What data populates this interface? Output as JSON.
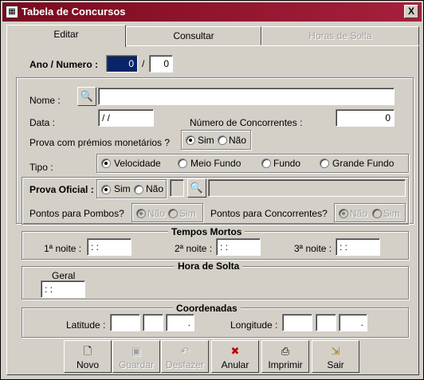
{
  "window": {
    "title": "Tabela de Concursos",
    "close_symbol": "X"
  },
  "tabs": [
    {
      "label": "Editar",
      "state": "active"
    },
    {
      "label": "Consultar",
      "state": "enabled"
    },
    {
      "label": "Horas de Solta",
      "state": "disabled"
    }
  ],
  "ano_numero": {
    "label": "Ano / Numero :",
    "ano": "0",
    "separator": "/",
    "numero": "0"
  },
  "nome": {
    "label": "Nome :",
    "value": ""
  },
  "data": {
    "label": "Data :",
    "value": " / /"
  },
  "num_concorrentes": {
    "label": "Número de Concorrentes :",
    "value": "0"
  },
  "premios": {
    "label": "Prova com prémios monetários ?",
    "options": [
      "Sim",
      "Não"
    ],
    "selected": "Sim"
  },
  "tipo": {
    "label": "Tipo :",
    "options": [
      "Velocidade",
      "Meio Fundo",
      "Fundo",
      "Grande Fundo"
    ],
    "selected": "Velocidade"
  },
  "prova_oficial": {
    "label": "Prova Oficial :",
    "options": [
      "Sim",
      "Não"
    ],
    "selected": "Sim",
    "code": "",
    "description": ""
  },
  "pontos_pombos": {
    "label": "Pontos para Pombos?",
    "options": [
      "Não",
      "Sim"
    ],
    "selected": "Não"
  },
  "pontos_concorrentes": {
    "label": "Pontos para Concorrentes?",
    "options": [
      "Não",
      "Sim"
    ],
    "selected": "Não"
  },
  "tempos_mortos": {
    "title": "Tempos Mortos",
    "noites": [
      {
        "label": "1ª noite :",
        "value": " : :"
      },
      {
        "label": "2ª noite :",
        "value": " : :"
      },
      {
        "label": "3ª noite :",
        "value": " : :"
      }
    ]
  },
  "hora_solta": {
    "title": "Hora de Solta",
    "geral_label": "Geral",
    "geral_value": " : :"
  },
  "coordenadas": {
    "title": "Coordenadas",
    "latitude_label": "Latitude :",
    "latitude": [
      "",
      "",
      "."
    ],
    "longitude_label": "Longitude :",
    "longitude": [
      "",
      "",
      "."
    ]
  },
  "toolbar": [
    {
      "label": "Novo",
      "icon": "new-document-icon",
      "glyph": "🗋",
      "enabled": true
    },
    {
      "label": "Guardar",
      "icon": "save-disk-icon",
      "glyph": "▣",
      "enabled": false
    },
    {
      "label": "Desfazer",
      "icon": "undo-icon",
      "glyph": "↶",
      "enabled": false
    },
    {
      "label": "Anular",
      "icon": "cancel-icon",
      "glyph": "✖",
      "enabled": true
    },
    {
      "label": "Imprimir",
      "icon": "printer-icon",
      "glyph": "⎙",
      "enabled": true
    },
    {
      "label": "Sair",
      "icon": "exit-icon",
      "glyph": "⇲",
      "enabled": true
    }
  ],
  "colors": {
    "titlebar": "#7a0a1e",
    "selection": "#0a246a",
    "face": "#d4d0c8"
  }
}
